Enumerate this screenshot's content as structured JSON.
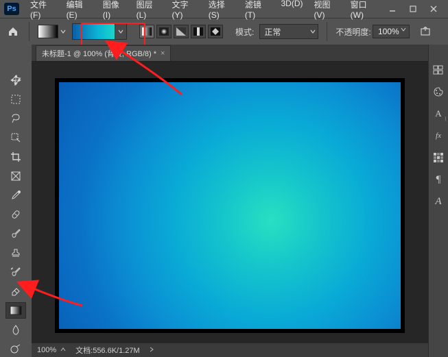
{
  "app": {
    "badge": "Ps"
  },
  "menu": {
    "file": "文件(F)",
    "edit": "编辑(E)",
    "image": "图像(I)",
    "layer": "图层(L)",
    "type": "文字(Y)",
    "select": "选择(S)",
    "filter": "滤镜(T)",
    "three_d": "3D(D)",
    "view": "视图(V)",
    "window": "窗口(W)"
  },
  "options": {
    "mode_label": "模式:",
    "mode_value": "正常",
    "opacity_label": "不透明度:",
    "opacity_value": "100%",
    "gradient_colors": [
      "#0a5ea8",
      "#0bb4d6",
      "#19d5c8"
    ]
  },
  "tab": {
    "title": "未标题-1 @ 100% (背景, RGB/8) *",
    "close": "×"
  },
  "status": {
    "zoom": "100%",
    "docinfo": "文档:556.6K/1.27M"
  },
  "right_panel_glyphs": {
    "history": "85",
    "color": "color",
    "char_a": "A",
    "fx": "fx",
    "swatches": "swatch",
    "para": "¶",
    "glyph_a": "A"
  }
}
